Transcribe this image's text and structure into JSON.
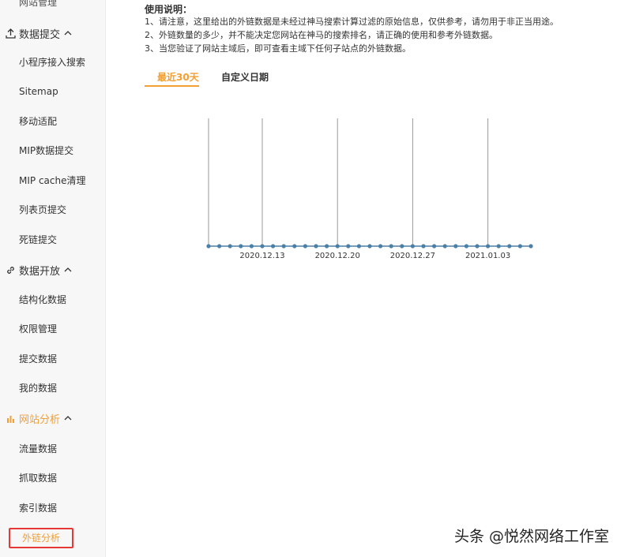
{
  "sidebar": {
    "top_item": "网站管理",
    "sections": [
      {
        "label": "数据提交",
        "icon": "upload-icon",
        "items": [
          "小程序接入搜索",
          "Sitemap",
          "移动适配",
          "MIP数据提交",
          "MIP cache清理",
          "列表页提交",
          "死链提交"
        ]
      },
      {
        "label": "数据开放",
        "icon": "link-icon",
        "items": [
          "结构化数据",
          "权限管理",
          "提交数据",
          "我的数据"
        ]
      },
      {
        "label": "网站分析",
        "icon": "bar-chart-icon",
        "items": [
          "流量数据",
          "抓取数据",
          "索引数据",
          "外链分析"
        ]
      }
    ]
  },
  "notes": {
    "title": "使用说明：",
    "lines": [
      "1、请注意，这里给出的外链数据是未经过神马搜索计算过滤的原始信息，仅供参考，请勿用于非正当用途。",
      "2、外链数量的多少，并不能决定您网站在神马的搜索排名，请正确的使用和参考外链数据。",
      "3、当您验证了网站主域后，即可查看主域下任何子站点的外链数据。"
    ]
  },
  "tabs": {
    "active": "最近30天",
    "inactive": "自定义日期"
  },
  "colors": {
    "accent": "#f29f33",
    "series": "#4a7fa8",
    "highlight_border": "#e53935"
  },
  "chart_data": {
    "type": "line",
    "x_tick_labels": [
      "2020.12.13",
      "2020.12.20",
      "2020.12.27",
      "2021.01.03"
    ],
    "point_count": 31,
    "values": [
      0,
      0,
      0,
      0,
      0,
      0,
      0,
      0,
      0,
      0,
      0,
      0,
      0,
      0,
      0,
      0,
      0,
      0,
      0,
      0,
      0,
      0,
      0,
      0,
      0,
      0,
      0,
      0,
      0,
      0,
      0
    ],
    "tick_indices": [
      5,
      12,
      19,
      26
    ]
  },
  "watermark": "头条 @悦然网络工作室"
}
